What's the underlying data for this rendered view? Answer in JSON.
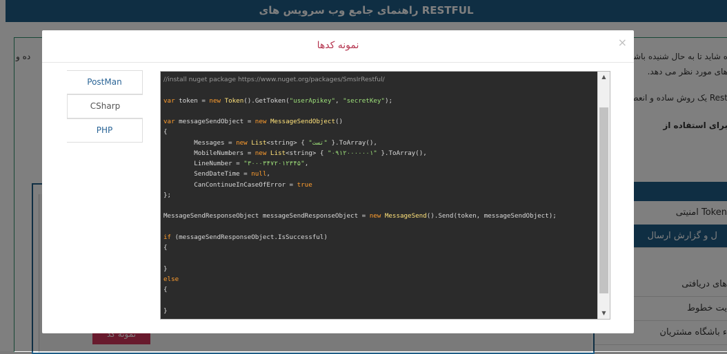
{
  "background": {
    "header_title": "راهنمای جامع وب سرویس های RESTFUL",
    "text_line1": "ه شاید تا به حال شنیده باشید",
    "text_line1b": "ده و",
    "text_line2": "های مورد نظر می دهد.",
    "text_line3": "Rest یک روش ساده و انعطاف پذیر",
    "text_line4": "برای استفاده از",
    "menu": [
      {
        "label": "Token امنیتی"
      },
      {
        "label": "ل و گزارش ارسال"
      },
      {
        "label": "های دریافتی"
      },
      {
        "label": "یت خطوط"
      },
      {
        "label": "ء باشگاه مشتریان"
      }
    ],
    "red_button_label": "نمونه کد"
  },
  "modal": {
    "title": "نمونه کدها",
    "close_label": "×",
    "tabs": [
      {
        "label": "PostMan",
        "active": false
      },
      {
        "label": "CSharp",
        "active": true
      },
      {
        "label": "PHP",
        "active": false
      }
    ]
  },
  "code": {
    "lines": [
      [
        {
          "t": "comment",
          "v": "//install nuget package https://www.nuget.org/packages/SmsIrRestful/"
        }
      ],
      [],
      [
        {
          "t": "kw",
          "v": "var"
        },
        {
          "t": "plain",
          "v": " token = "
        },
        {
          "t": "kw",
          "v": "new"
        },
        {
          "t": "plain",
          "v": " "
        },
        {
          "t": "type",
          "v": "Token"
        },
        {
          "t": "plain",
          "v": "().GetToken("
        },
        {
          "t": "str",
          "v": "\"userApikey\""
        },
        {
          "t": "plain",
          "v": ", "
        },
        {
          "t": "str",
          "v": "\"secretKey\""
        },
        {
          "t": "plain",
          "v": ");"
        }
      ],
      [],
      [
        {
          "t": "kw",
          "v": "var"
        },
        {
          "t": "plain",
          "v": " messageSendObject = "
        },
        {
          "t": "kw",
          "v": "new"
        },
        {
          "t": "plain",
          "v": " "
        },
        {
          "t": "type",
          "v": "MessageSendObject"
        },
        {
          "t": "plain",
          "v": "()"
        }
      ],
      [
        {
          "t": "plain",
          "v": "{"
        }
      ],
      [
        {
          "t": "plain",
          "v": "        Messages = "
        },
        {
          "t": "kw",
          "v": "new"
        },
        {
          "t": "plain",
          "v": " "
        },
        {
          "t": "type",
          "v": "List"
        },
        {
          "t": "plain",
          "v": "<string> { "
        },
        {
          "t": "str",
          "v": "\"تست\""
        },
        {
          "t": "plain",
          "v": " }.ToArray(),"
        }
      ],
      [
        {
          "t": "plain",
          "v": "        MobileNumbers = "
        },
        {
          "t": "kw",
          "v": "new"
        },
        {
          "t": "plain",
          "v": " "
        },
        {
          "t": "type",
          "v": "List"
        },
        {
          "t": "plain",
          "v": "<string> { "
        },
        {
          "t": "str",
          "v": "\"۰۹۱۲۰۰۰۰۰۰۱\""
        },
        {
          "t": "plain",
          "v": " }.ToArray(),"
        }
      ],
      [
        {
          "t": "plain",
          "v": "        LineNumber = "
        },
        {
          "t": "str",
          "v": "\"۳۰۰۰۳۴۷۲۰۱۲۳۴۵\""
        },
        {
          "t": "plain",
          "v": ","
        }
      ],
      [
        {
          "t": "plain",
          "v": "        SendDateTime = "
        },
        {
          "t": "kw",
          "v": "null"
        },
        {
          "t": "plain",
          "v": ","
        }
      ],
      [
        {
          "t": "plain",
          "v": "        CanContinueInCaseOfError = "
        },
        {
          "t": "kw",
          "v": "true"
        }
      ],
      [
        {
          "t": "plain",
          "v": "};"
        }
      ],
      [],
      [
        {
          "t": "plain",
          "v": "MessageSendResponseObject messageSendResponseObject = "
        },
        {
          "t": "kw",
          "v": "new"
        },
        {
          "t": "plain",
          "v": " "
        },
        {
          "t": "type",
          "v": "MessageSend"
        },
        {
          "t": "plain",
          "v": "().Send(token, messageSendObject);"
        }
      ],
      [],
      [
        {
          "t": "kw",
          "v": "if"
        },
        {
          "t": "plain",
          "v": " (messageSendResponseObject.IsSuccessful)"
        }
      ],
      [
        {
          "t": "plain",
          "v": "{"
        }
      ],
      [],
      [
        {
          "t": "plain",
          "v": "}"
        }
      ],
      [
        {
          "t": "kw",
          "v": "else"
        }
      ],
      [
        {
          "t": "plain",
          "v": "{"
        }
      ],
      [],
      [
        {
          "t": "plain",
          "v": "}"
        }
      ]
    ]
  },
  "scrollbar": {
    "up_icon": "▲",
    "down_icon": "▼",
    "position_fraction": 0.0
  },
  "colors": {
    "accent_title": "#b5354f",
    "header_blue": "#1f5d86",
    "code_bg": "#2b2b2b",
    "keyword": "#ff9d2e",
    "type": "#ffe27a",
    "string": "#9ee07a",
    "comment": "#9a9a9a"
  }
}
